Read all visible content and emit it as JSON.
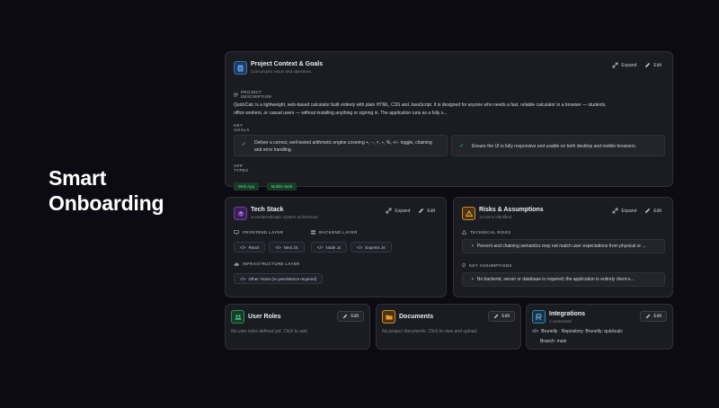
{
  "hero": {
    "line1": "Smart",
    "line2": "Onboarding"
  },
  "project": {
    "title": "Project Context & Goals",
    "subtitle": "Core project vision and objectives",
    "expand": "Expand",
    "edit": "Edit",
    "description_label_1": "PROJECT",
    "description_label_2": "DESCRIPTION",
    "description_line1": "QuickCalc is a lightweight, web-based calculator built entirely with plain HTML, CSS and JavaScript. It is designed for anyone who needs a fast, reliable calculator in a browser — students,",
    "description_line2": "office workers, or casual users — without installing anything or signing in. The application runs as a fully s...",
    "goals_label_1": "KEY",
    "goals_label_2": "GOALS",
    "goals": [
      {
        "line1": "Deliver a correct, well-tested arithmetic engine covering +, −, ×, ÷, %, +/− toggle, chaining",
        "line2": "and error handling."
      },
      {
        "line1": "Ensure the UI is fully responsive and usable on both desktop and mobile browsers.",
        "line2": ""
      }
    ],
    "types_label_1": "APP",
    "types_label_2": "TYPES",
    "types": [
      "Web App",
      "Mobile Web"
    ]
  },
  "tech": {
    "title": "Tech Stack",
    "subtitle": "ui-rendered/static system architecture",
    "expand": "Expand",
    "edit": "Edit",
    "frontend_label": "FRONTEND LAYER",
    "frontend": [
      "React",
      "Next JS"
    ],
    "backend_label": "BACKEND LAYER",
    "backend": [
      "Node Js",
      "Express Js"
    ],
    "infra_label": "INFRASTRUCTURE LAYER",
    "infra": [
      "Other: None (no persistence required)"
    ]
  },
  "risks": {
    "title": "Risks & Assumptions",
    "subtitle": "14 items identified",
    "expand": "Expand",
    "edit": "Edit",
    "technical_label": "TECHNICAL RISKS",
    "technical": "Percent and chaining semantics may not match user expectations from physical or ...",
    "assumptions_label": "KEY ASSUMPTIONS",
    "assumptions": "No backend, server or database is required; the application is entirely client-s..."
  },
  "roles": {
    "title": "User Roles",
    "edit": "Edit",
    "empty": "No user roles defined yet. Click to add."
  },
  "docs": {
    "title": "Documents",
    "edit": "Edit",
    "empty": "No project documents. Click to view and upload."
  },
  "integrations": {
    "title": "Integrations",
    "subtitle": "1 connected",
    "edit": "Edit",
    "line1": "Brunelly · Repository: Brunelly: quickcalc",
    "line2": "Branch: main"
  }
}
